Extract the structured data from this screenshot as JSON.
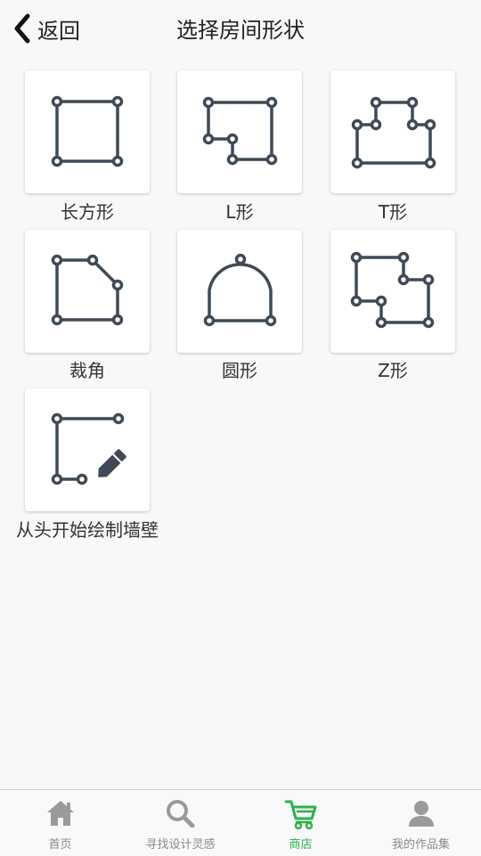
{
  "header": {
    "back_label": "返回",
    "title": "选择房间形状"
  },
  "shapes": [
    {
      "label": "长方形"
    },
    {
      "label": "L形"
    },
    {
      "label": "T形"
    },
    {
      "label": "裁角"
    },
    {
      "label": "圆形"
    },
    {
      "label": "Z形"
    },
    {
      "label": "从头开始绘制墙壁"
    }
  ],
  "tabs": [
    {
      "label": "首页",
      "icon": "home-icon"
    },
    {
      "label": "寻找设计灵感",
      "icon": "search-icon"
    },
    {
      "label": "商店",
      "icon": "cart-icon",
      "active": true
    },
    {
      "label": "我的作品集",
      "icon": "user-icon"
    }
  ],
  "colors": {
    "shape_stroke": "#3f4a56",
    "active_tab": "#2bb24c",
    "inactive_tab": "#9a9a9a"
  }
}
